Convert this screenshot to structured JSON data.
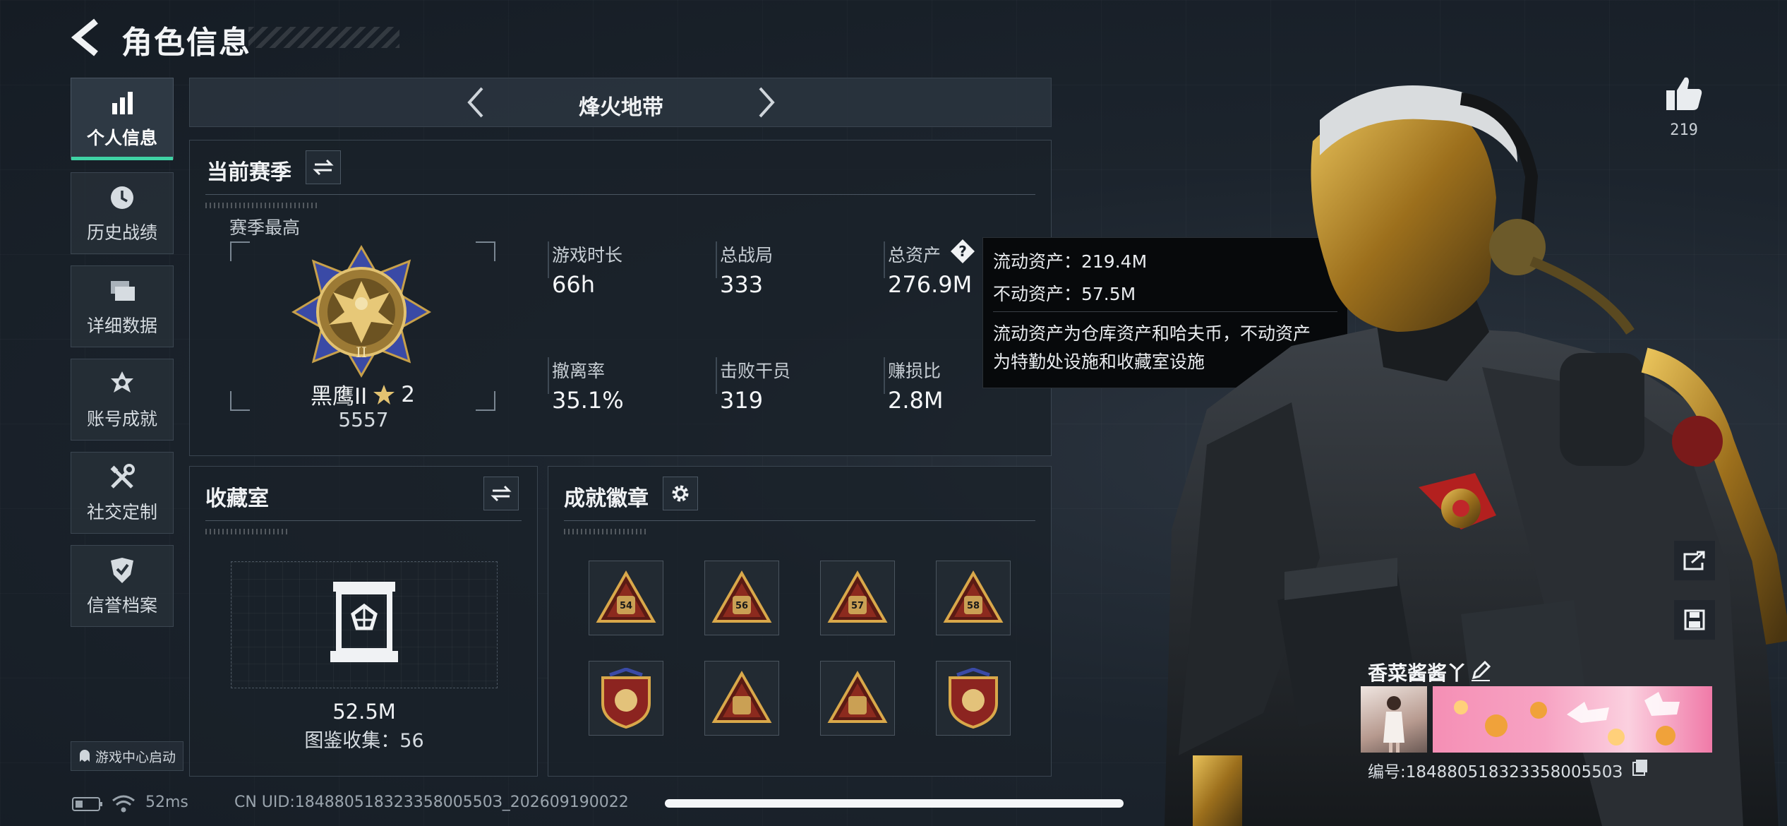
{
  "header": {
    "title": "角色信息"
  },
  "sidebar": {
    "items": [
      {
        "label": "个人信息",
        "icon": "bar-chart-icon",
        "active": true
      },
      {
        "label": "历史战绩",
        "icon": "clock-icon"
      },
      {
        "label": "详细数据",
        "icon": "folders-icon"
      },
      {
        "label": "账号成就",
        "icon": "medal-icon"
      },
      {
        "label": "社交定制",
        "icon": "tools-icon"
      },
      {
        "label": "信誉档案",
        "icon": "shield-check-icon"
      }
    ],
    "game_center": "游戏中心启动"
  },
  "mode": {
    "label": "烽火地带"
  },
  "season": {
    "title": "当前赛季",
    "best_label": "赛季最高",
    "rank_name": "黑鹰II",
    "rank_stars": "2",
    "rank_points": "5557",
    "stats": [
      {
        "label": "游戏时长",
        "value": "66h"
      },
      {
        "label": "总战局",
        "value": "333"
      },
      {
        "label": "总资产",
        "value": "276.9M"
      },
      {
        "label": "撤离率",
        "value": "35.1%"
      },
      {
        "label": "击败干员",
        "value": "319"
      },
      {
        "label": "赚损比",
        "value": "2.8M"
      }
    ]
  },
  "tooltip": {
    "liquid": "流动资产：219.4M",
    "fixed": "不动资产：57.5M",
    "desc_line1": "流动资产为仓库资产和哈夫币，不动资产",
    "desc_line2": "为特勤处设施和收藏室设施"
  },
  "collection": {
    "title": "收藏室",
    "value": "52.5M",
    "catalog": "图鉴收集：56"
  },
  "achievements": {
    "title": "成就徽章",
    "badges": [
      "54",
      "56",
      "57",
      "58",
      "",
      "",
      "",
      ""
    ]
  },
  "profile": {
    "likes": "219",
    "nickname": "香菜酱酱丫",
    "player_id": "编号:18488051832335800550З"
  },
  "status_bar": {
    "ping": "52ms",
    "uid": "CN UID:18488051832335800550З_202609190022"
  },
  "colors": {
    "accent": "#3fd3a5",
    "background": "#182029",
    "gold": "#c79a3a"
  }
}
